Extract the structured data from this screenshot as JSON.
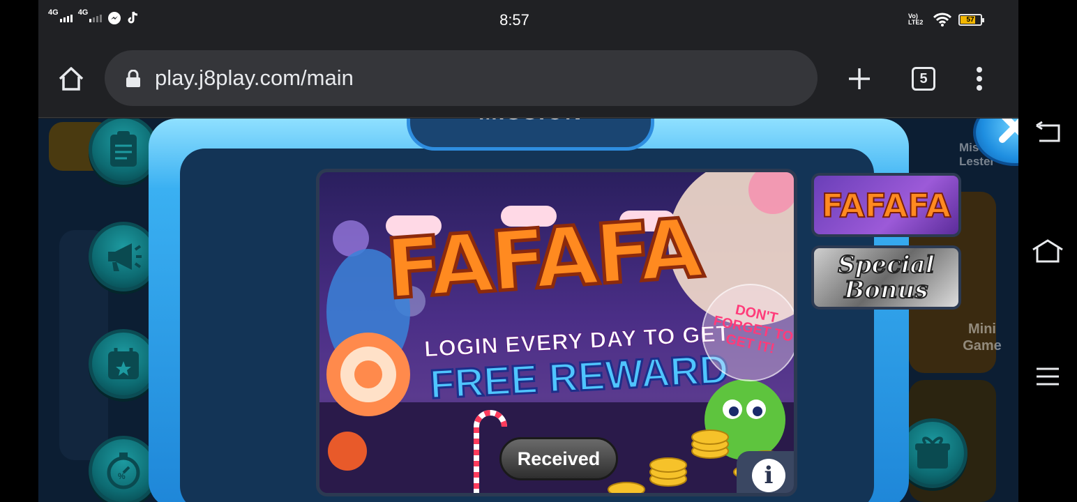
{
  "status_bar": {
    "network1": "4G",
    "network2": "4G",
    "time": "8:57",
    "volte": "Vo) LTE2",
    "battery_level": "57",
    "battery_color": "#f2b600"
  },
  "browser": {
    "url": "play.j8play.com/main",
    "tab_count": "5",
    "home_icon": "home-icon",
    "new_tab_icon": "plus-icon",
    "menu_icon": "more-vertical-icon"
  },
  "game_bg": {
    "player_name": "Miss Lester",
    "mini_game_label": "Mini Game"
  },
  "modal": {
    "title": "MISSION",
    "banner": {
      "logo": "FAFAFA",
      "line1": "LOGIN EVERY DAY TO GET",
      "line2": "FREE REWARD",
      "note": "DON'T FORGET TO GET IT!",
      "received_label": "Received",
      "info_label": "i"
    },
    "thumbnails": [
      {
        "label": "FAFAFA"
      },
      {
        "label": "Special Bonus"
      }
    ]
  },
  "colors": {
    "modal_frame": "#3ab0f2",
    "modal_inner": "#133456",
    "side_button": "#0d6b72"
  }
}
